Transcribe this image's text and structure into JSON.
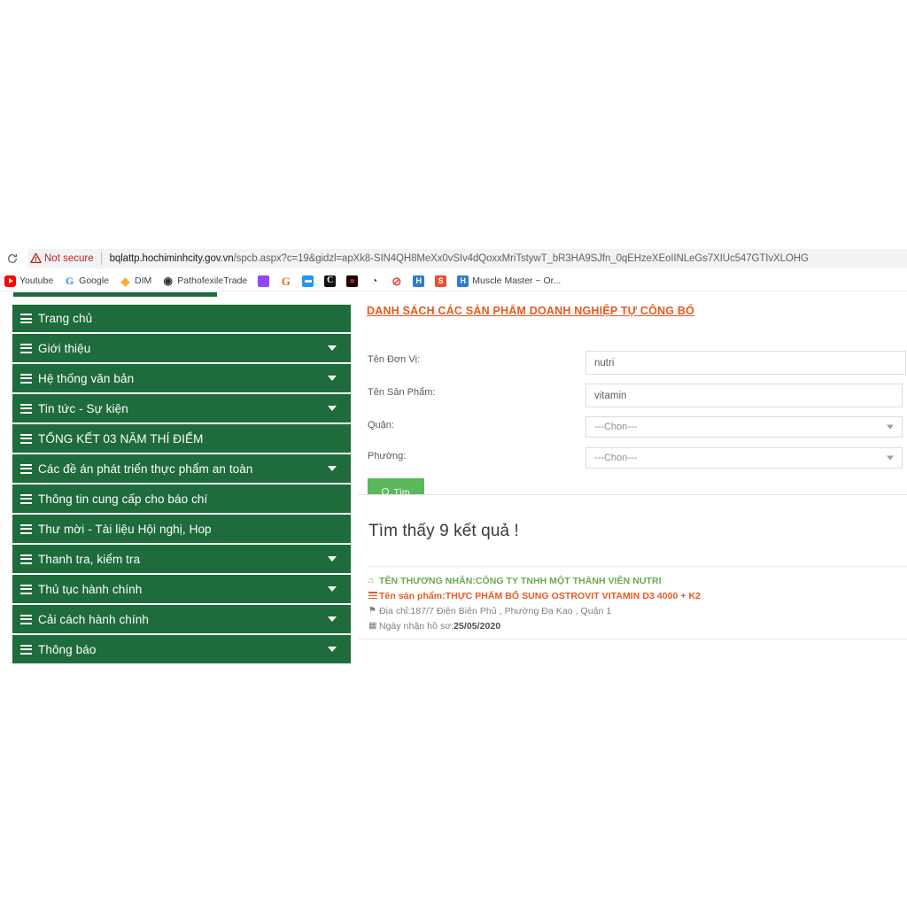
{
  "browser": {
    "reload_icon": "reload-icon",
    "security_label": "Not secure",
    "url_host": "bqlattp.hochiminhcity.gov.vn",
    "url_path": "/spcb.aspx?c=19&gidzl=apXk8-SIN4QH8MeXx0vSIv4dQoxxMriTstywT_bR3HA9SJfn_0qEHzeXEoIINLeGs7XIUc547GTIvXLOHG",
    "bookmarks": [
      {
        "label": "Youtube",
        "icon": "youtube-icon",
        "cls": "ico-youtube",
        "glyph": ""
      },
      {
        "label": "Google",
        "icon": "google-icon",
        "cls": "ico-google",
        "glyph": "G"
      },
      {
        "label": "DIM",
        "icon": "dim-icon",
        "cls": "ico-dim",
        "glyph": "◈"
      },
      {
        "label": "PathofexileTrade",
        "icon": "pathofexile-icon",
        "cls": "ico-patho",
        "glyph": "◉"
      },
      {
        "label": "",
        "icon": "twitch-icon",
        "cls": "ico-twitch",
        "glyph": ""
      },
      {
        "label": "",
        "icon": "g-orange-icon",
        "cls": "ico-g2",
        "glyph": "G"
      },
      {
        "label": "",
        "icon": "blue-square-icon",
        "cls": "ico-blue",
        "glyph": ""
      },
      {
        "label": "",
        "icon": "crescent-c-icon",
        "cls": "ico-c",
        "glyph": "C"
      },
      {
        "label": "",
        "icon": "dark-red-square-icon",
        "cls": "ico-darkred",
        "glyph": "■"
      },
      {
        "label": "",
        "icon": "dark-circle-icon",
        "cls": "ico-dark",
        "glyph": "◔"
      },
      {
        "label": "",
        "icon": "red-slash-circle-icon",
        "cls": "ico-red",
        "glyph": "⊘"
      },
      {
        "label": "",
        "icon": "blue-h-icon",
        "cls": "ico-h1",
        "glyph": "H"
      },
      {
        "label": "",
        "icon": "shopee-icon",
        "cls": "ico-shopee",
        "glyph": "S"
      },
      {
        "label": "Muscle Master ~ Or...",
        "icon": "blue-h2-icon",
        "cls": "ico-h2",
        "glyph": "H"
      }
    ]
  },
  "sidebar": {
    "items": [
      {
        "label": "Trang chủ",
        "caret": false
      },
      {
        "label": "Giới thiệu",
        "caret": true
      },
      {
        "label": "Hệ thống văn bản",
        "caret": true
      },
      {
        "label": "Tin tức - Sự kiện",
        "caret": true
      },
      {
        "label": "TỔNG KẾT 03 NĂM THÍ ĐIỂM",
        "caret": false
      },
      {
        "label": "Các đề án phát triển thực phẩm an toàn",
        "caret": true
      },
      {
        "label": "Thông tin cung cấp cho báo chí",
        "caret": false
      },
      {
        "label": "Thư mời - Tài liệu Hội nghị, Hop",
        "caret": false
      },
      {
        "label": "Thanh tra, kiểm tra",
        "caret": true
      },
      {
        "label": "Thủ tục hành chính",
        "caret": true
      },
      {
        "label": "Cải cách hành chính",
        "caret": true
      },
      {
        "label": "Thông báo",
        "caret": true
      }
    ]
  },
  "content": {
    "panel_title": "DANH SÁCH CÁC SẢN PHẨM DOANH NGHIỆP TỰ CÔNG BỐ",
    "form": {
      "fields": [
        {
          "label": "Tên Đơn Vị:",
          "type": "text",
          "value": "nutri"
        },
        {
          "label": "Tên Sản Phẩm:",
          "type": "text",
          "value": "vitamin"
        },
        {
          "label": "Quận:",
          "type": "select",
          "value": "---Chon---"
        },
        {
          "label": "Phường:",
          "type": "select",
          "value": "---Chon---"
        }
      ],
      "search_button_label": "Tìm"
    },
    "results": {
      "count_text": "Tìm thấy 9 kết quả !",
      "items": [
        {
          "merchant_prefix": "TÊN THƯƠNG NHÂN:",
          "merchant_name": "CÔNG TY TNHH MỘT THÀNH VIÊN NUTRI",
          "product_prefix": "Tên sản phẩm:",
          "product_name": "THỰC PHẨM BỔ SUNG OSTROVIT VITAMIN D3 4000 + K2",
          "address_prefix": "Địa chỉ:",
          "address": "187/7 Điện Biên Phủ , Phường Đa Kao , Quận 1",
          "date_prefix": "Ngày nhận hồ sơ:",
          "date": "25/05/2020"
        }
      ]
    }
  },
  "colors": {
    "sidebar_green": "#1e6b3c",
    "accent_orange": "#e8591e",
    "merchant_green": "#6aa84f",
    "button_green": "#5cb85c",
    "not_secure_red": "#c5221f"
  }
}
